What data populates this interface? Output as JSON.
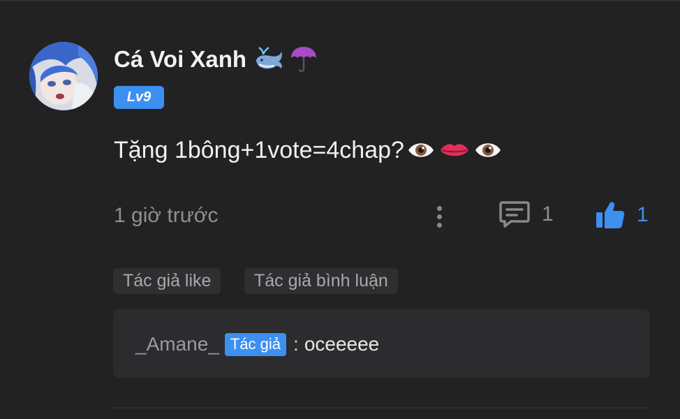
{
  "comment": {
    "username": "Cá Voi Xanh",
    "username_icons": [
      "whale-emoji",
      "umbrella-emoji"
    ],
    "level": "Lv9",
    "text": "Tặng 1bông+1vote=4chap?",
    "text_icons": [
      "eye-emoji",
      "lips-emoji",
      "eye-emoji"
    ],
    "timestamp": "1 giờ trước",
    "reply_count": "1",
    "like_count": "1"
  },
  "tags": {
    "author_liked": "Tác giả like",
    "author_commented": "Tác giả bình luận"
  },
  "reply": {
    "author": "_Amane_",
    "author_badge": "Tác giả",
    "separator": ":",
    "text": "oceeeee"
  },
  "colors": {
    "background": "#222223",
    "accent": "#3d8ff0",
    "muted_text": "#8f8f92",
    "tag_background": "#2f2f31",
    "reply_background": "#2c2c2e"
  }
}
